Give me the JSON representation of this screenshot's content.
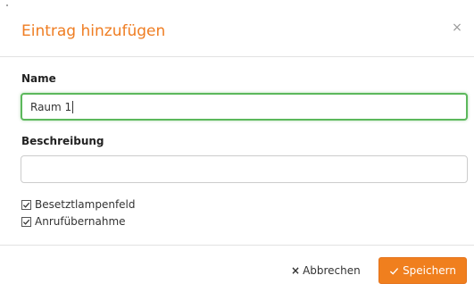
{
  "dialog": {
    "title": "Eintrag hinzufügen",
    "close_icon": "close-icon",
    "close_symbol": "×"
  },
  "form": {
    "name_label": "Name",
    "name_value": "Raum 1",
    "description_label": "Beschreibung",
    "description_value": "",
    "checkboxes": [
      {
        "label": "Besetztlampenfeld",
        "checked": true
      },
      {
        "label": "Anrufübernahme",
        "checked": true
      }
    ]
  },
  "footer": {
    "cancel_label": "Abbrechen",
    "cancel_icon_symbol": "×",
    "save_label": "Speichern"
  },
  "colors": {
    "accent": "#ef7d22",
    "focus_border": "#5cb85c",
    "save_button": "#f07f1e"
  }
}
